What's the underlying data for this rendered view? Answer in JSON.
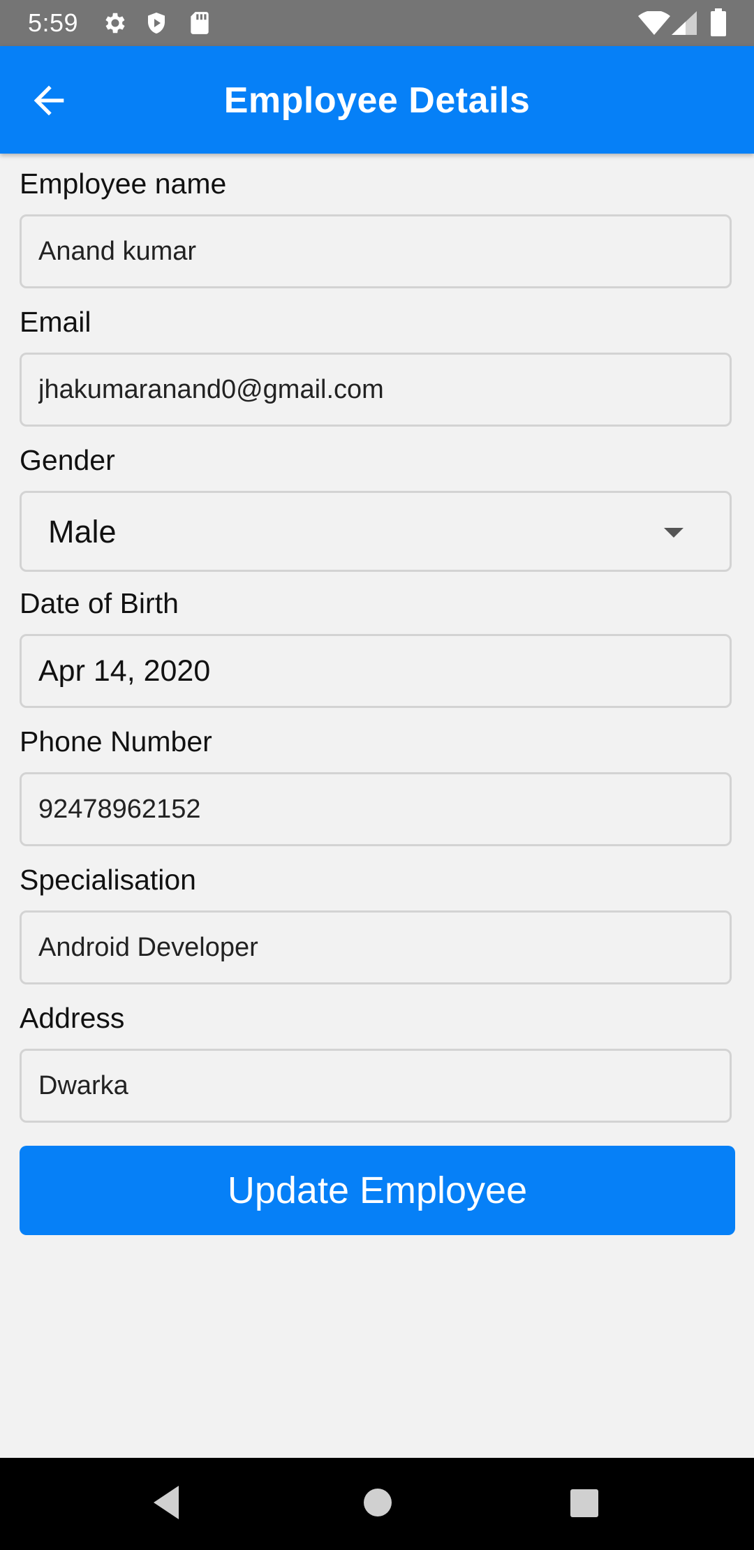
{
  "status_bar": {
    "time": "5:59",
    "left_icons": [
      "gear-icon",
      "shield-icon",
      "sd-card-icon"
    ],
    "right_icons": [
      "wifi-icon",
      "signal-icon",
      "battery-icon"
    ]
  },
  "app_bar": {
    "title": "Employee Details",
    "back_icon": "arrow-left-icon"
  },
  "form": {
    "name_label": "Employee name",
    "name_value": "Anand kumar",
    "email_label": "Email",
    "email_value": "jhakumaranand0@gmail.com",
    "gender_label": "Gender",
    "gender_value": "Male",
    "dob_label": "Date of Birth",
    "dob_value": "Apr 14, 2020",
    "phone_label": "Phone Number",
    "phone_value": "92478962152",
    "specialisation_label": "Specialisation",
    "specialisation_value": "Android Developer",
    "address_label": "Address",
    "address_value": "Dwarka"
  },
  "actions": {
    "update_label": "Update Employee"
  },
  "nav_bar": {
    "buttons": [
      "back-triangle-icon",
      "home-circle-icon",
      "recents-square-icon"
    ]
  },
  "colors": {
    "accent": "#0680f7",
    "status_bar": "#757575",
    "background": "#f2f2f2",
    "field_border": "#d3d3d3"
  }
}
